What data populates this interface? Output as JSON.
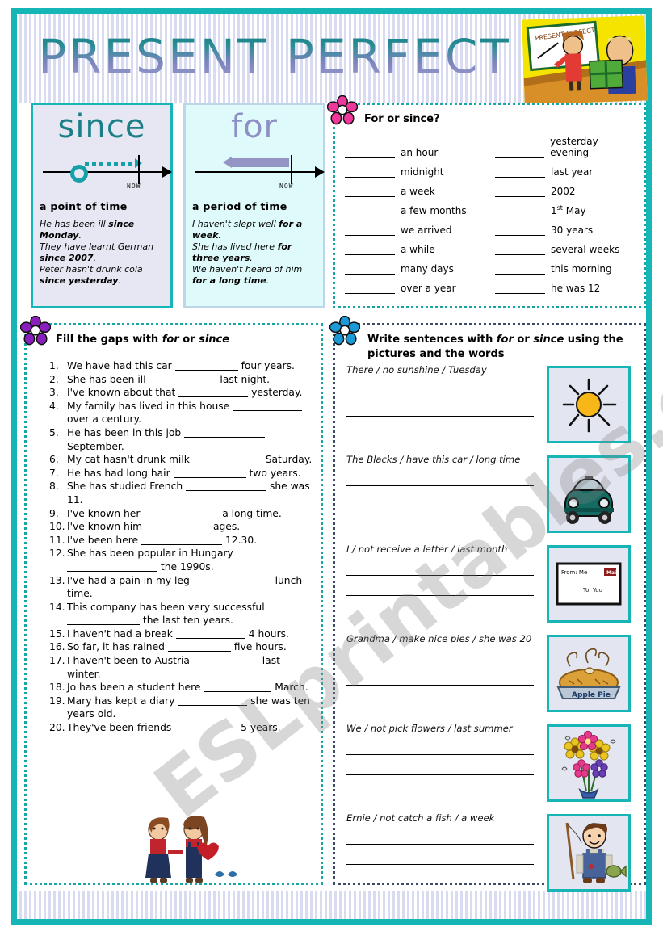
{
  "title": "PRESENT PERFECT",
  "watermark": "ESLprintables.com",
  "clipart": {
    "teacher_board_text": "PRESENT PERFECT",
    "teacher_alt": "teacher-pointing-at-whiteboard",
    "boy_alt": "boy-holding-green-present"
  },
  "since_box": {
    "word": "since",
    "timeline_now_label": "NOW",
    "definition": "a point of time",
    "examples": [
      {
        "pre": "He has been ill ",
        "bold": "since Monday",
        "post": "."
      },
      {
        "pre": "They have learnt German ",
        "bold": "since 2007",
        "post": "."
      },
      {
        "pre": "Peter hasn't drunk cola ",
        "bold": "since yesterday",
        "post": "."
      }
    ]
  },
  "for_box": {
    "word": "for",
    "timeline_now_label": "NOW",
    "definition": "a period of time",
    "examples": [
      {
        "pre": "I haven't slept well ",
        "bold": "for a week",
        "post": "."
      },
      {
        "pre": "She has lived here ",
        "bold": "for three years",
        "post": "."
      },
      {
        "pre": "We haven't heard of him ",
        "bold": "for a long time",
        "post": "."
      }
    ]
  },
  "for_or_since": {
    "heading": "For or since?",
    "flower_color": "#f0379c",
    "left_column": [
      "an hour",
      "midnight",
      "a week",
      "a few months",
      "we arrived",
      "a while",
      "many days",
      "over a year"
    ],
    "right_column": [
      "yesterday evening",
      "last year",
      "2002",
      "1st May",
      "30 years",
      "several weeks",
      "this morning",
      "he was 12"
    ]
  },
  "fill_gaps": {
    "heading_pre": "Fill the gaps with ",
    "heading_em1": "for",
    "heading_mid": " or ",
    "heading_em2": "since",
    "flower_color": "#8b1fbd",
    "items": [
      {
        "n": "1.",
        "a": "We have had this car",
        "gap": 78,
        "b": "four years."
      },
      {
        "n": "2.",
        "a": "She has been ill",
        "gap": 84,
        "b": "last night."
      },
      {
        "n": "3.",
        "a": "I've known about that",
        "gap": 86,
        "b": "yesterday."
      },
      {
        "n": "4.",
        "a": "My family has lived in this house",
        "gap": 86,
        "b": "over a century."
      },
      {
        "n": "5.",
        "a": "He has been in this job",
        "gap": 100,
        "b": "September."
      },
      {
        "n": "6.",
        "a": "My cat hasn't drunk milk",
        "gap": 86,
        "b": "Saturday."
      },
      {
        "n": "7.",
        "a": "He has had long hair",
        "gap": 90,
        "b": "two years."
      },
      {
        "n": "8.",
        "a": "She has studied French",
        "gap": 100,
        "b": "she was 11."
      },
      {
        "n": "9.",
        "a": "I've known her",
        "gap": 94,
        "b": "a long time."
      },
      {
        "n": "10.",
        "a": "I've known him",
        "gap": 80,
        "b": "ages."
      },
      {
        "n": "11.",
        "a": "I've been here",
        "gap": 100,
        "b": "12.30."
      },
      {
        "n": "12.",
        "a": "She has been popular in Hungary",
        "gap": 112,
        "b": "the 1990s."
      },
      {
        "n": "13.",
        "a": "I've had a pain in my leg",
        "gap": 98,
        "b": "lunch time."
      },
      {
        "n": "14.",
        "a": "This company has been very successful",
        "gap": 90,
        "b": "the last ten years."
      },
      {
        "n": "15.",
        "a": "I haven't had a break",
        "gap": 86,
        "b": "4 hours."
      },
      {
        "n": "16.",
        "a": "So far, it has rained",
        "gap": 78,
        "b": "five hours."
      },
      {
        "n": "17.",
        "a": "I haven't been to Austria",
        "gap": 82,
        "b": "last winter."
      },
      {
        "n": "18.",
        "a": "Jo has been a student here",
        "gap": 84,
        "b": "March."
      },
      {
        "n": "19.",
        "a": "Mary has kept a diary",
        "gap": 86,
        "b": "she was ten years old."
      },
      {
        "n": "20.",
        "a": "They've been friends",
        "gap": 78,
        "b": "5 years."
      }
    ],
    "bottom_clipart_alt": "two-dolls-holding-hands-with-heart"
  },
  "write_sentences": {
    "heading_pre": "Write sentences with ",
    "heading_em1": "for",
    "heading_mid": " or ",
    "heading_em2": "since",
    "heading_post": " using the pictures and the words",
    "flower_color": "#1b9ad6",
    "prompts": [
      {
        "text": "There / no sunshine / Tuesday",
        "picture": "sun-icon"
      },
      {
        "text": "The Blacks / have this car / long time",
        "picture": "car-icon"
      },
      {
        "text": "I / not receive a letter / last month",
        "picture": "envelope-icon"
      },
      {
        "text": "Grandma / make nice pies / she was 20",
        "picture": "apple-pie-icon"
      },
      {
        "text": "We / not pick flowers / last summer",
        "picture": "flower-bouquet-icon"
      },
      {
        "text": "Ernie / not catch a fish / a week",
        "picture": "boy-fishing-icon"
      }
    ],
    "envelope_labels": {
      "from": "From: Me",
      "to": "To: You",
      "stamp": "Mail"
    },
    "pie_label": "Apple Pie"
  },
  "colors": {
    "frame_teal": "#16b6b6",
    "dotted_teal": "#17a6a6",
    "dotted_navy": "#3d4a63",
    "since_text": "#1a7f86",
    "for_text": "#8e8fc4",
    "pic_border": "#17b5b5",
    "pic_bg": "#e3e5f0"
  }
}
